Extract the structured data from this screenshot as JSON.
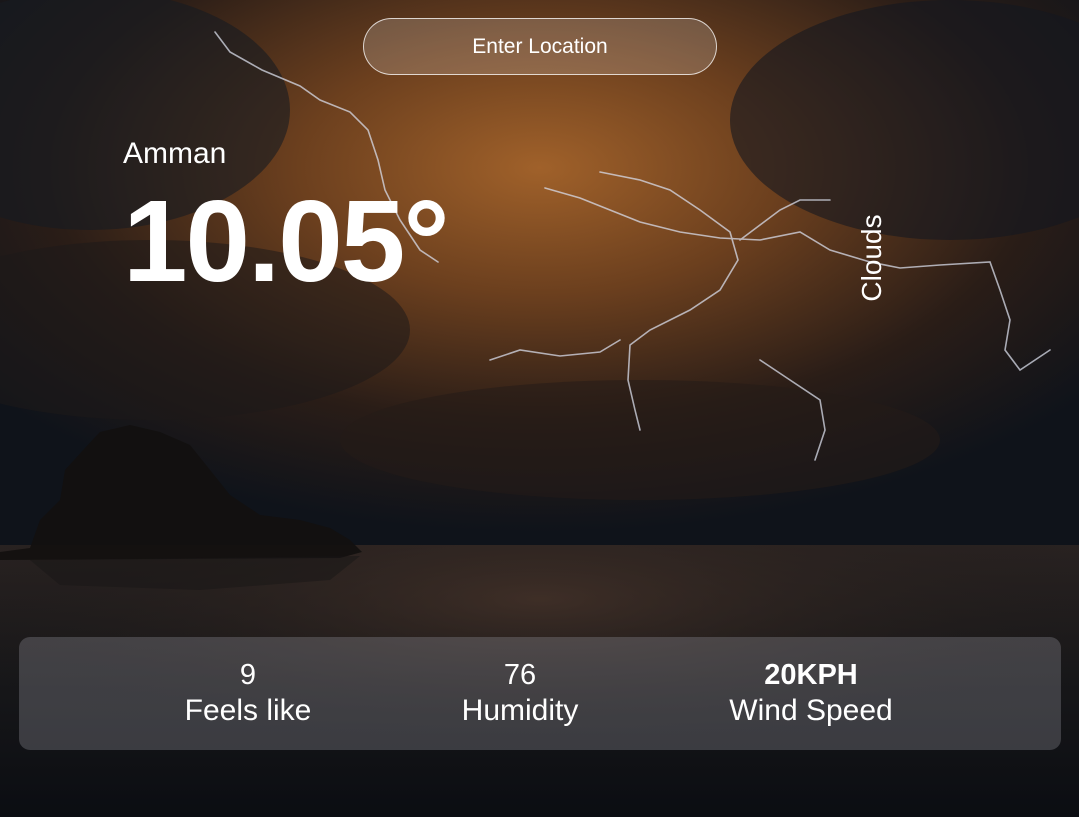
{
  "search": {
    "placeholder": "Enter Location"
  },
  "weather": {
    "location": "Amman",
    "temperature": "10.05°",
    "condition": "Clouds"
  },
  "stats": {
    "feels_like": {
      "value": "9",
      "label": "Feels like"
    },
    "humidity": {
      "value": "76",
      "label": "Humidity"
    },
    "wind_speed": {
      "value": "20KPH",
      "label": "Wind Speed"
    }
  },
  "colors": {
    "text": "#ffffff",
    "sky_glow": "#8a5426",
    "sky_dark": "#10151d",
    "panel": "rgba(150,150,160,0.32)"
  }
}
